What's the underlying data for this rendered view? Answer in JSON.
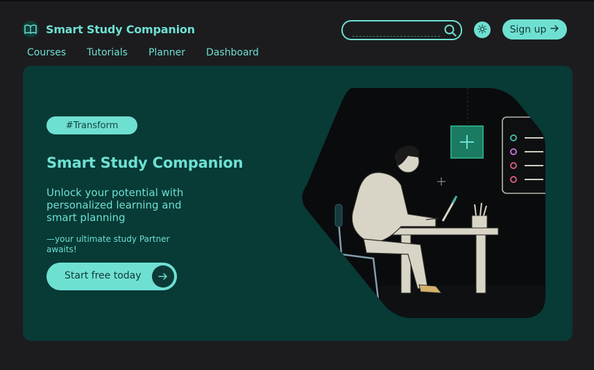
{
  "header": {
    "brand_title": "Smart Study Companion",
    "search": {
      "value": "",
      "placeholder": ""
    },
    "signup_label": "Sign up"
  },
  "nav": {
    "items": [
      "Courses",
      "Tutorials",
      "Planner",
      "Dashboard"
    ]
  },
  "hero": {
    "tag": "#Transform",
    "title": "Smart Study Companion",
    "subtitle": "Unlock your potential with personalized learning and smart planning",
    "note": "—your ultimate study Partner awaits!",
    "cta_label": "Start free today"
  },
  "colors": {
    "accent": "#6ee0d2",
    "hero_bg": "#083a36",
    "page_bg": "#1c1c1e"
  },
  "icons": [
    "book-icon",
    "search-icon",
    "sun-icon",
    "arrow-right-icon"
  ]
}
